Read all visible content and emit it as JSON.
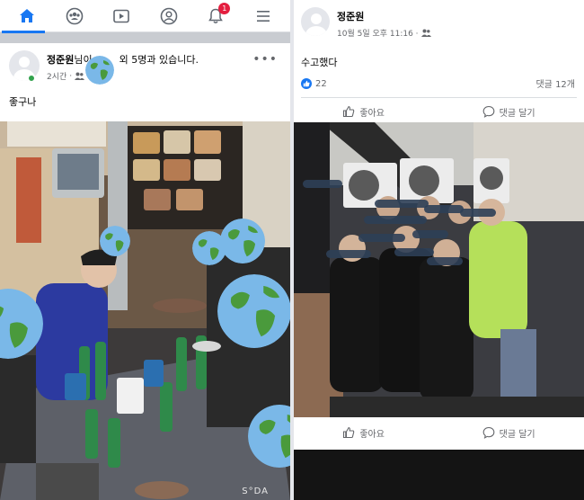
{
  "left": {
    "nav": {
      "items": [
        {
          "name": "home-icon",
          "active": true
        },
        {
          "name": "groups-icon"
        },
        {
          "name": "watch-icon"
        },
        {
          "name": "profile-icon"
        },
        {
          "name": "notifications-icon",
          "badge": "1"
        },
        {
          "name": "menu-icon"
        }
      ]
    },
    "post": {
      "author": "정준원",
      "with_prefix": "님이",
      "with_suffix": "외 5명과 있습니다.",
      "time": "2시간",
      "privacy_icon": "friends-icon",
      "text": "좋구나"
    },
    "photo": {
      "watermark": "S°DA"
    }
  },
  "right": {
    "post": {
      "author": "정준원",
      "time": "10월 5일 오후 11:16 ·",
      "privacy_icon": "friends-icon",
      "text": "수고했다",
      "like_count": "22",
      "comment_count": "댓글 12개",
      "like_label": "좋아요",
      "comment_label": "댓글 달기"
    },
    "bottom_actions": {
      "like_label": "좋아요",
      "comment_label": "댓글 달기"
    }
  },
  "colors": {
    "accent": "#1877f2",
    "badge": "#e41e3f",
    "online": "#31a24c"
  }
}
